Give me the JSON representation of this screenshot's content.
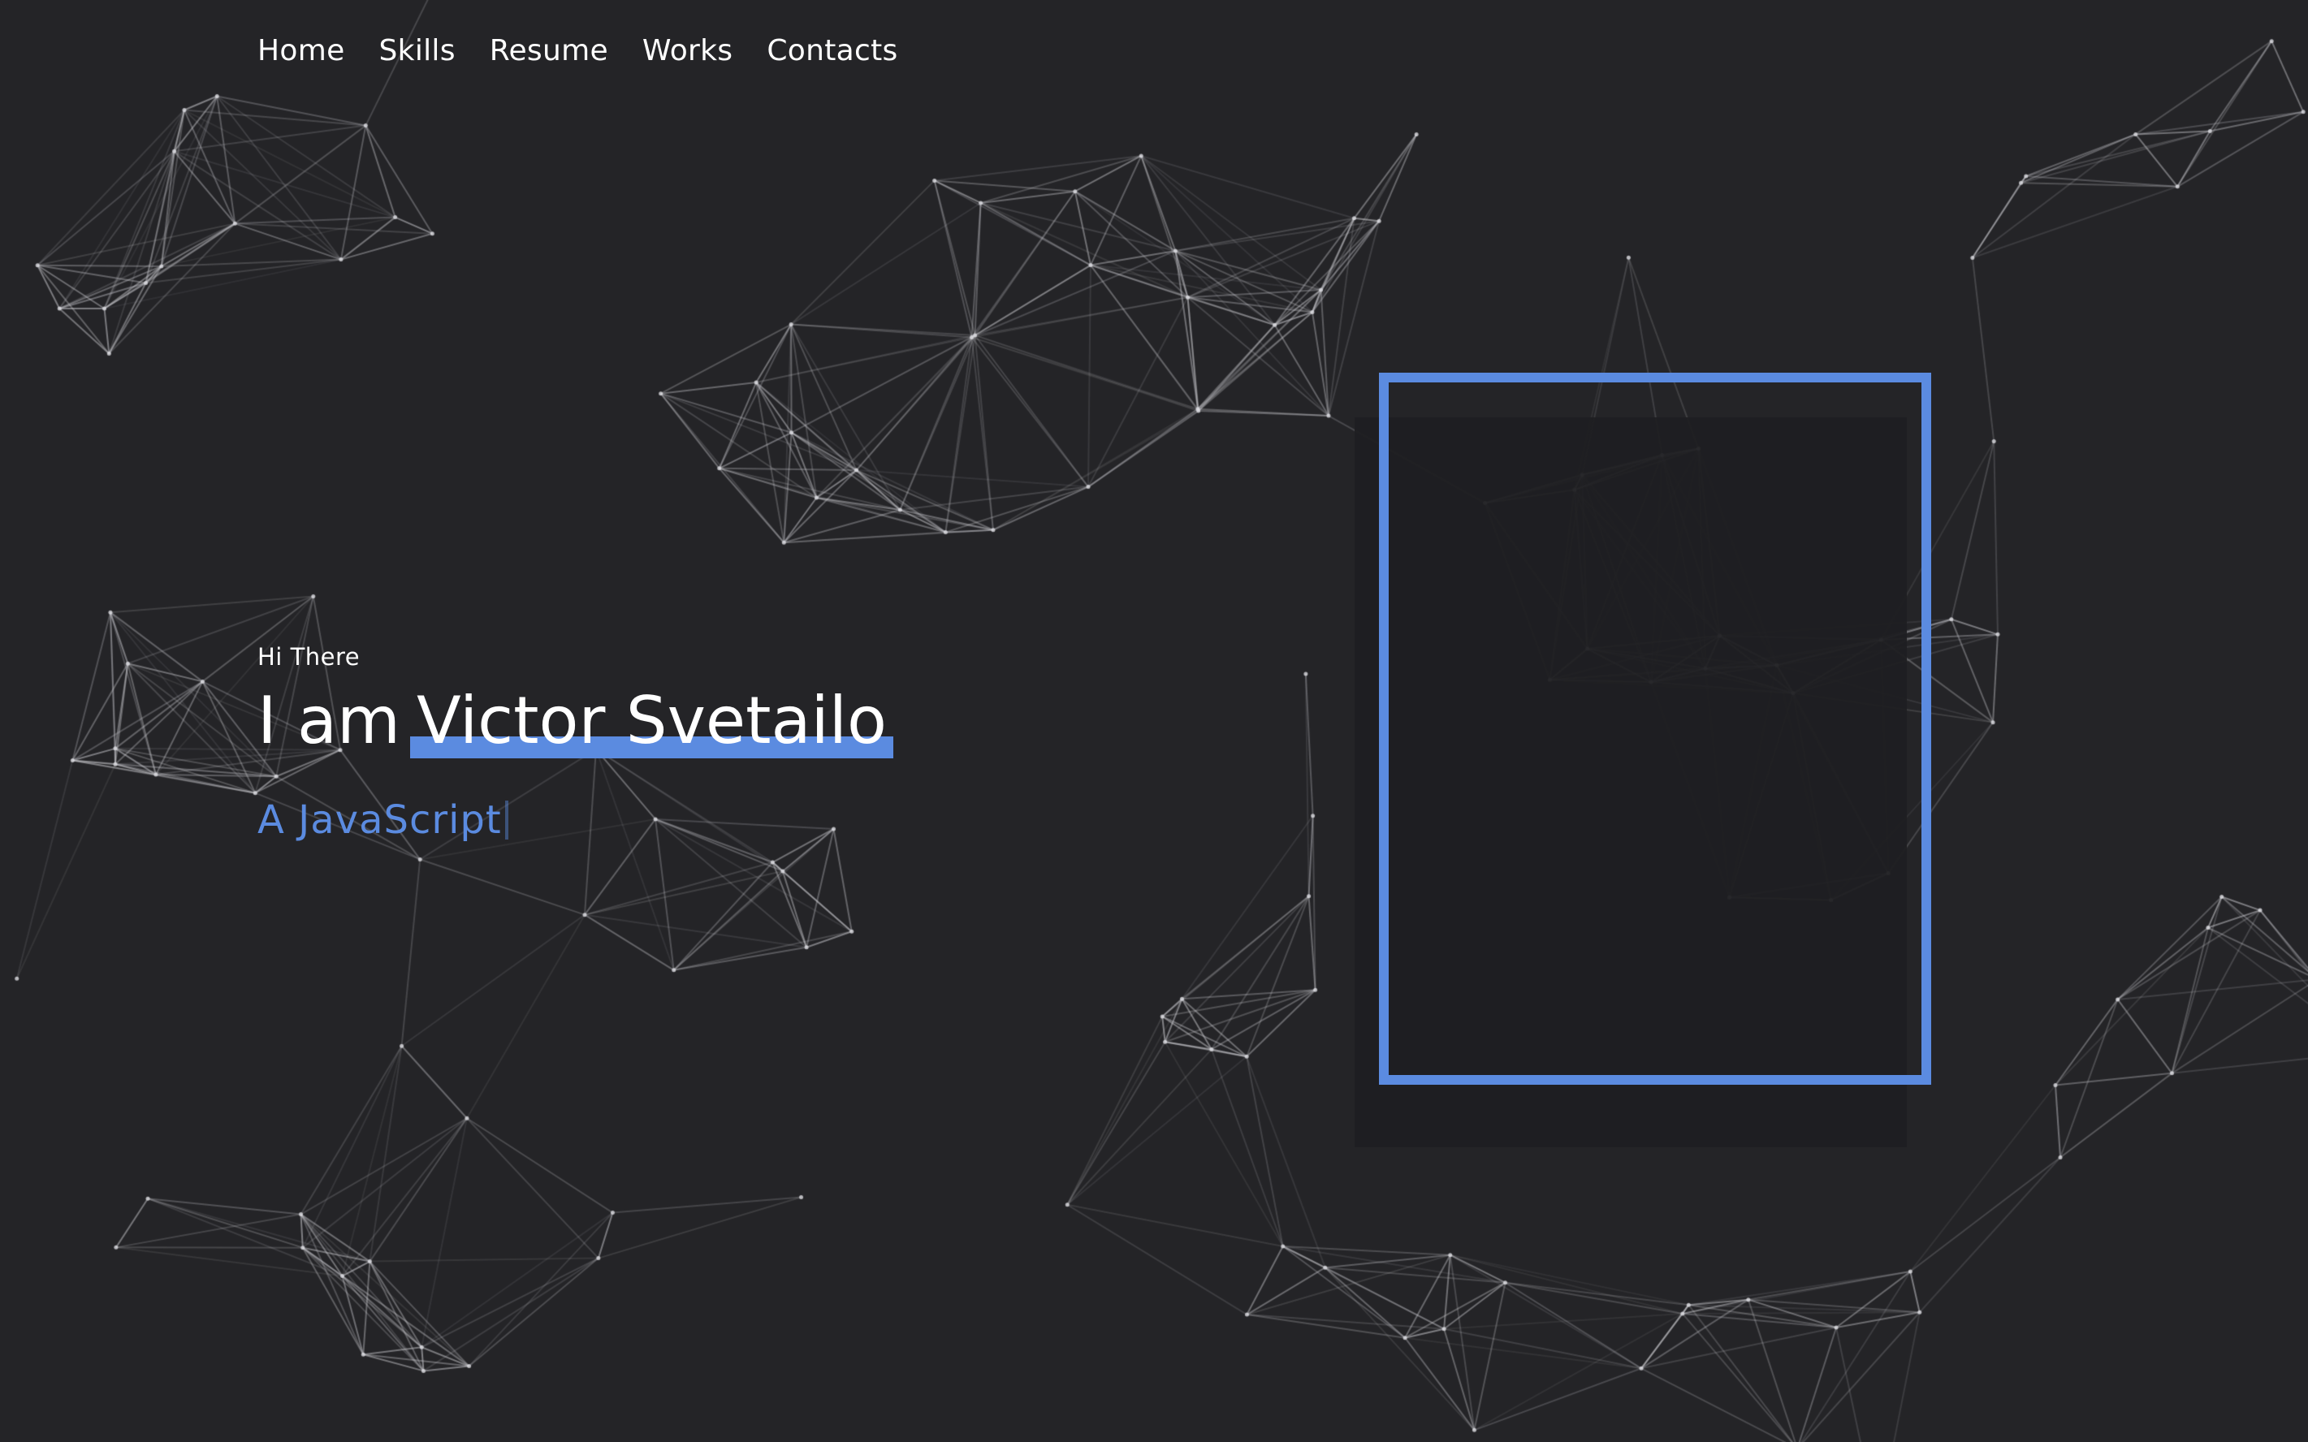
{
  "nav": {
    "items": [
      "Home",
      "Skills",
      "Resume",
      "Works",
      "Contacts"
    ]
  },
  "hero": {
    "greeting": "Hi There",
    "intro": "I am",
    "name": "Victor Svetailo",
    "role": "A JavaScript"
  },
  "colors": {
    "background": "#242427",
    "accent": "#5b8be0",
    "text": "#ffffff"
  }
}
